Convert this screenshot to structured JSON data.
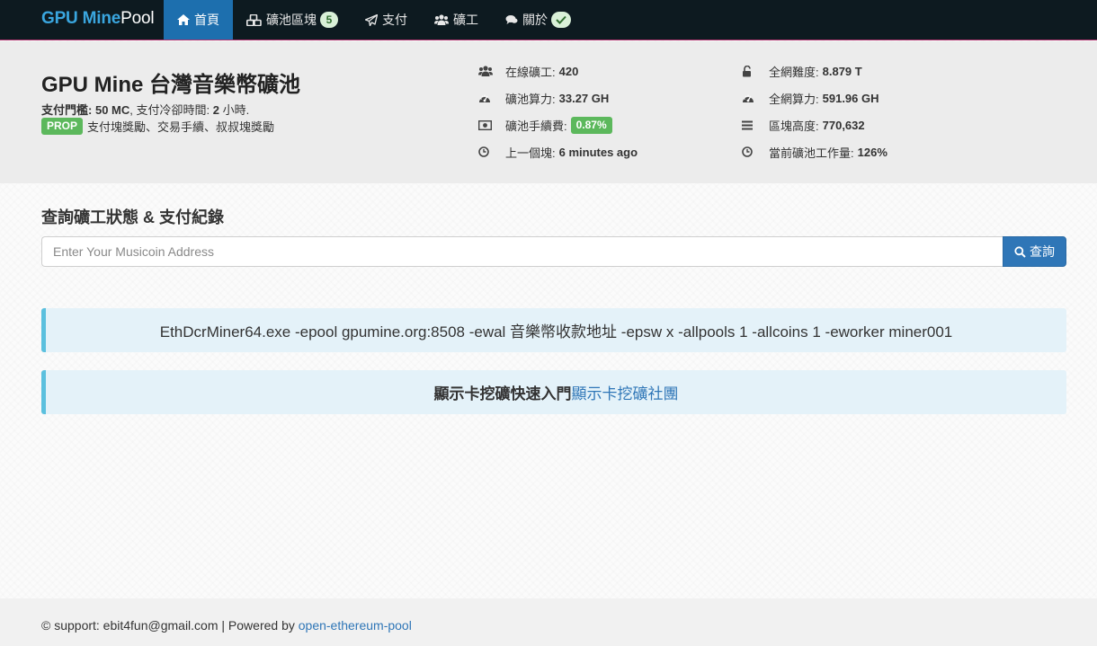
{
  "navbar": {
    "brand_part1": "GPU Mine",
    "brand_part2": "Pool",
    "items": [
      {
        "label": "首頁",
        "icon": "home-icon"
      },
      {
        "label": "礦池區塊",
        "icon": "cubes-icon",
        "badge": "5"
      },
      {
        "label": "支付",
        "icon": "paper-plane-icon"
      },
      {
        "label": "礦工",
        "icon": "users-icon"
      },
      {
        "label": "關於",
        "icon": "comments-icon",
        "badge_icon": "check-icon"
      }
    ],
    "active_index": 0
  },
  "header": {
    "title": "GPU Mine 台灣音樂幣礦池",
    "payout_threshold_label": "支付門檻:",
    "payout_threshold_value": "50 MC",
    "cooldown_label": ", 支付冷卻時間:",
    "cooldown_value": "2",
    "cooldown_unit": "小時.",
    "scheme_badge": "PROP",
    "scheme_desc": "支付塊獎勵、交易手續、叔叔塊獎勵"
  },
  "stats_left": [
    {
      "icon": "users-icon",
      "label": "在線礦工:",
      "value": "420"
    },
    {
      "icon": "dashboard-icon",
      "label": "礦池算力:",
      "value": "33.27 GH"
    },
    {
      "icon": "money-icon",
      "label": "礦池手續費:",
      "value": "0.87%",
      "badge": true
    },
    {
      "icon": "clock-icon",
      "label": "上一個塊:",
      "value": "6 minutes ago"
    }
  ],
  "stats_right": [
    {
      "icon": "unlock-icon",
      "label": "全網難度:",
      "value": "8.879 T"
    },
    {
      "icon": "dashboard-icon",
      "label": "全網算力:",
      "value": "591.96 GH"
    },
    {
      "icon": "bars-icon",
      "label": "區塊高度:",
      "value": "770,632"
    },
    {
      "icon": "clock-icon",
      "label": "當前礦池工作量:",
      "value": "126%"
    }
  ],
  "query": {
    "title": "查詢礦工狀態 & 支付紀錄",
    "placeholder": "Enter Your Musicoin Address",
    "button_label": "查詢"
  },
  "alerts": {
    "command": "EthDcrMiner64.exe -epool gpumine.org:8508 -ewal 音樂幣收款地址 -epsw x -allpools 1 -allcoins 1 -eworker miner001",
    "guide_bold": "顯示卡挖礦快速入門",
    "guide_link": "顯示卡挖礦社團"
  },
  "footer": {
    "prefix": "© support: ebit4fun@gmail.com | Powered by ",
    "link": "open-ethereum-pool"
  },
  "colors": {
    "navbar_bg": "#0d1a20",
    "brand_blue": "#3aa6df",
    "nav_active": "#1d6fae",
    "success_green": "#5cb85c",
    "primary_blue": "#2f76b7",
    "info_border": "#5bc0de"
  }
}
